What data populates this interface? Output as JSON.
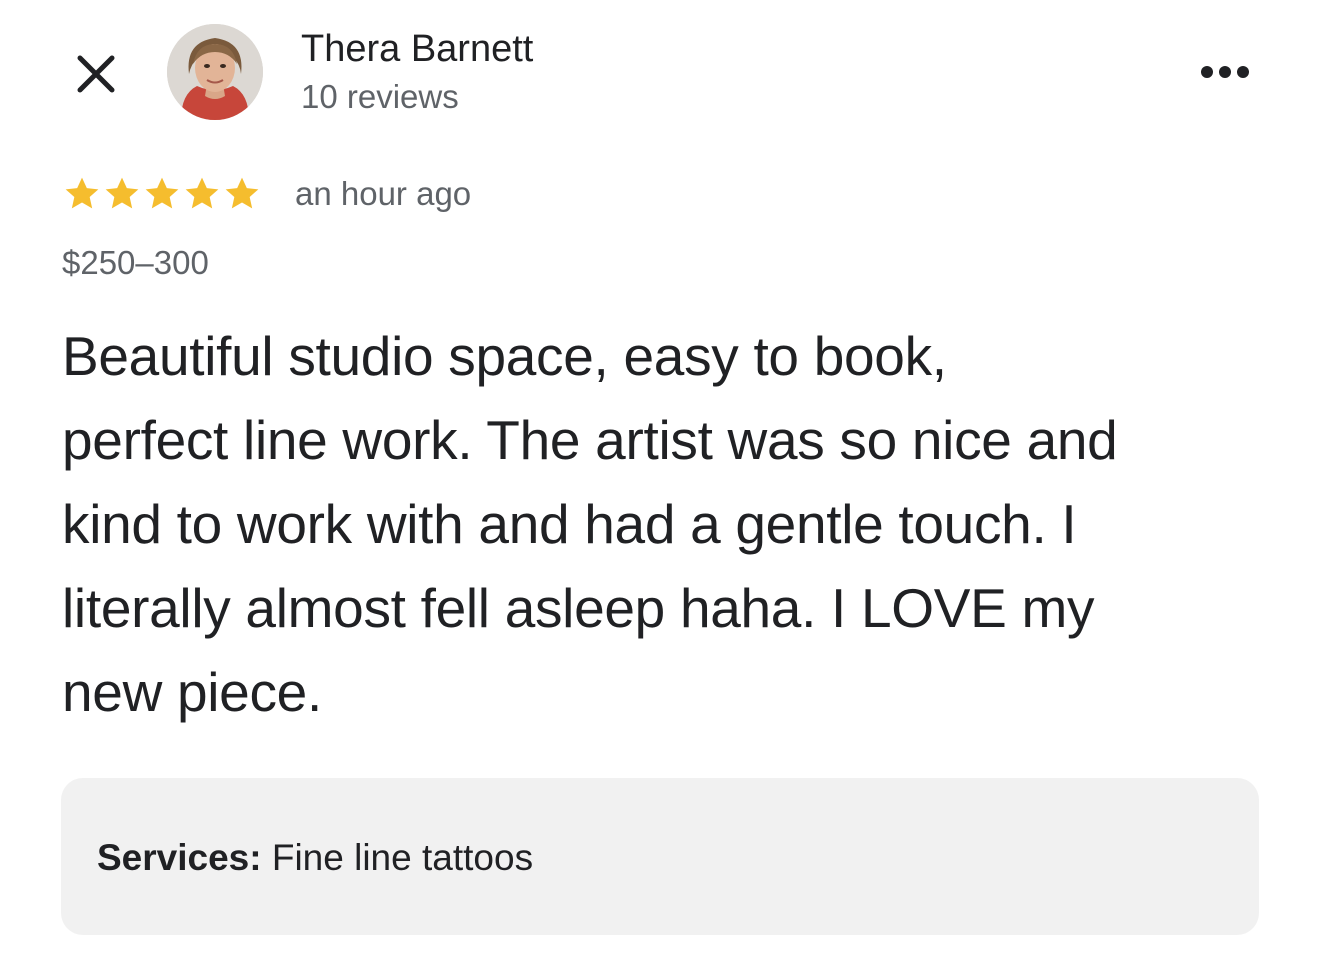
{
  "header": {
    "close_icon": "close-icon",
    "reviewer_name": "Thera Barnett",
    "review_count": "10 reviews",
    "more_icon": "more-horiz-icon"
  },
  "review": {
    "rating": 5,
    "rating_max": 5,
    "star_color": "#f5bd2e",
    "time": "an hour ago",
    "price": "$250–300",
    "text_lines": [
      "Beautiful studio space, easy to book,",
      "perfect line work. The artist was so nice and",
      "kind to work with and had a gentle touch. I",
      "literally almost fell asleep haha. I LOVE my",
      "new piece."
    ]
  },
  "services": {
    "label": "Services:",
    "value": "Fine line tattoos"
  }
}
